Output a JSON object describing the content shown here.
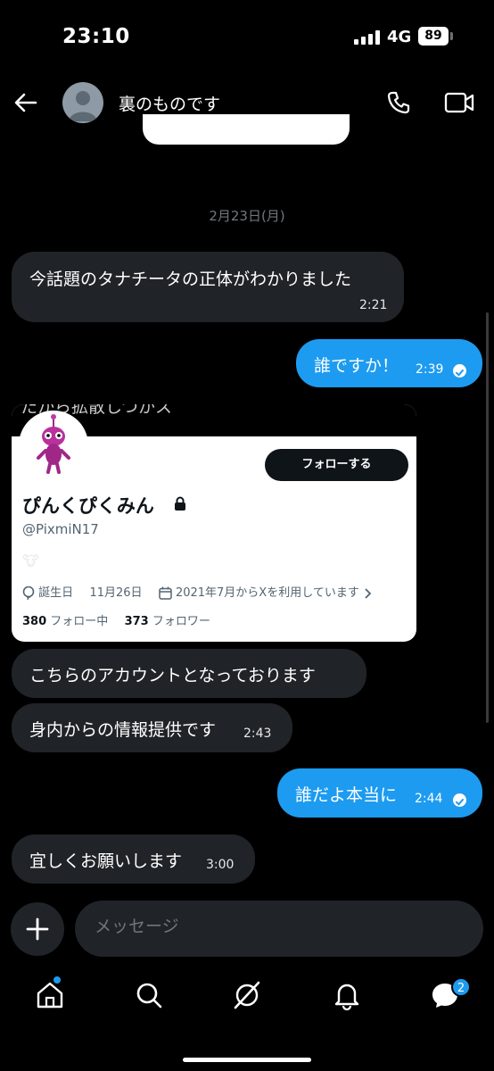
{
  "status_bar": {
    "time": "23:10",
    "network": "4G",
    "battery": "89"
  },
  "header": {
    "contact_name": "裏のものです"
  },
  "date_separator": "2月23日(月)",
  "messages": [
    {
      "text": "今話題のタナチータの正体がわかりました",
      "time": "2:21",
      "direction": "in"
    },
    {
      "text": "誰ですか！",
      "time": "2:39",
      "direction": "out"
    },
    {
      "text": "こちらのアカウントとなっております",
      "time": "",
      "direction": "in"
    },
    {
      "text": "身内からの情報提供です",
      "time": "2:43",
      "direction": "in"
    },
    {
      "text": "誰だよ本当に",
      "time": "2:44",
      "direction": "out"
    },
    {
      "text": "宜しくお願いします",
      "time": "3:00",
      "direction": "in"
    }
  ],
  "profile_card": {
    "partial_text": "たから拡散しつかス",
    "follow_label": "フォローする",
    "name": "ぴんくぴくみん",
    "handle": "@PixmiN17",
    "bio_emoji": "🐮",
    "birthday_label": "誕生日",
    "birthday": "11月26日",
    "joined": "2021年7月からXを利用しています",
    "following_count": "380",
    "following_label": "フォロー中",
    "followers_count": "373",
    "followers_label": "フォロワー"
  },
  "composer": {
    "placeholder": "メッセージ"
  },
  "tabbar": {
    "messages_badge": "2"
  },
  "colors": {
    "accent": "#1d9bf0",
    "incoming_bubble": "#202327",
    "background": "#000000"
  }
}
